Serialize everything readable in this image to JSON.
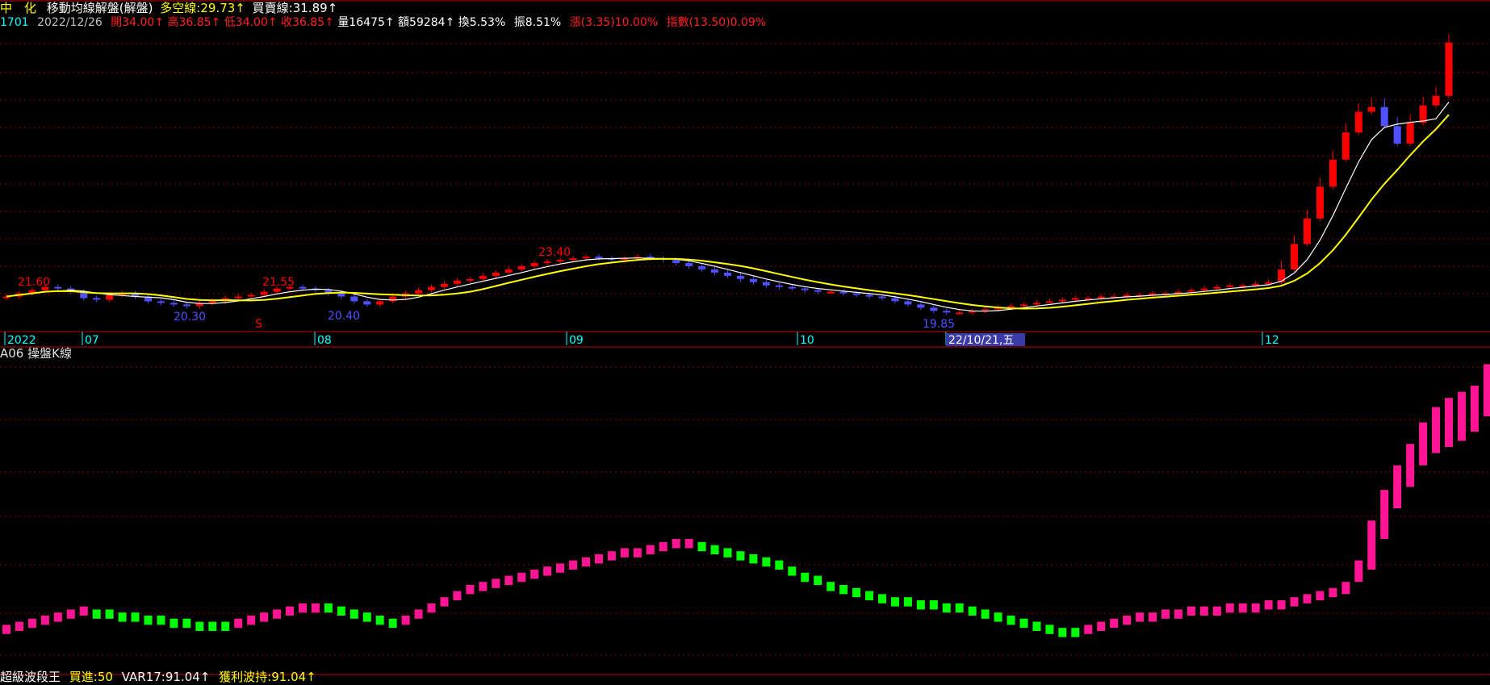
{
  "header": {
    "stock_name": "中　化",
    "indicator": "移動均線解盤(解盤)",
    "long_short_label": "多空線:29.73↑",
    "buy_sell_label": "買賣線:31.89↑"
  },
  "quote": {
    "code": "1701",
    "date": "2022/12/26",
    "open": "開34.00↑",
    "high": "高36.85↑",
    "low": "低34.00↑",
    "close": "收36.85↑",
    "volume": "量16475↑",
    "amount": "額59284↑",
    "turnover": "換5.53%",
    "amplitude": "振8.51%",
    "change": "漲(3.35)10.00%",
    "index": "指數(13.50)0.09%"
  },
  "sub_panel": {
    "title": "A06 操盤K線"
  },
  "footer": {
    "name": "超級波段王",
    "buy": "買進:50",
    "var": "VAR17:91.04↑",
    "profit": "獲利波持:91.04↑"
  },
  "colors": {
    "up": "#ff0000",
    "down": "#5050ff",
    "ma_fast": "#ffffff",
    "ma_slow": "#ffff00",
    "osc_up": "#ff1493",
    "osc_down": "#00ff00",
    "grid": "#8b0000",
    "axis_text": "#00ffff"
  },
  "chart_data": [
    {
      "type": "candlestick",
      "title": "移動均線解盤(解盤)",
      "x_labels": [
        "2022",
        "07",
        "08",
        "09",
        "10",
        "22/10/21,五",
        "12"
      ],
      "annotations": [
        {
          "text": "21.60",
          "kind": "high"
        },
        {
          "text": "21.55",
          "kind": "high"
        },
        {
          "text": "23.40",
          "kind": "high"
        },
        {
          "text": "20.30",
          "kind": "low"
        },
        {
          "text": "20.40",
          "kind": "low"
        },
        {
          "text": "19.85",
          "kind": "low"
        },
        {
          "text": "S",
          "kind": "signal"
        }
      ],
      "series": [
        {
          "name": "多空線",
          "value": 29.73
        },
        {
          "name": "買賣線",
          "value": 31.89
        }
      ],
      "ohlc_last": {
        "open": 34.0,
        "high": 36.85,
        "low": 34.0,
        "close": 36.85
      },
      "ylim": [
        19.0,
        38.0
      ],
      "close_values": [
        20.9,
        21.1,
        21.3,
        21.5,
        21.4,
        21.2,
        20.8,
        20.7,
        21.0,
        21.1,
        20.9,
        20.6,
        20.5,
        20.4,
        20.3,
        20.5,
        20.6,
        20.8,
        20.9,
        21.0,
        21.2,
        21.4,
        21.5,
        21.4,
        21.3,
        21.1,
        20.9,
        20.6,
        20.4,
        20.6,
        20.9,
        21.1,
        21.3,
        21.5,
        21.7,
        21.9,
        22.0,
        22.2,
        22.4,
        22.6,
        22.8,
        23.0,
        23.1,
        23.2,
        23.3,
        23.4,
        23.3,
        23.2,
        23.3,
        23.4,
        23.3,
        23.2,
        23.0,
        22.8,
        22.6,
        22.4,
        22.2,
        22.0,
        21.8,
        21.6,
        21.5,
        21.4,
        21.3,
        21.2,
        21.2,
        21.1,
        21.0,
        20.9,
        20.8,
        20.6,
        20.4,
        20.2,
        20.0,
        19.9,
        19.9,
        20.0,
        20.1,
        20.2,
        20.3,
        20.4,
        20.5,
        20.6,
        20.7,
        20.8,
        20.8,
        20.9,
        20.9,
        21.0,
        21.0,
        21.1,
        21.1,
        21.2,
        21.3,
        21.4,
        21.5,
        21.6,
        21.6,
        21.7,
        21.8,
        22.6,
        24.2,
        25.8,
        27.8,
        29.5,
        31.2,
        32.5,
        32.8,
        31.6,
        30.5,
        31.8,
        32.9,
        33.5,
        36.85
      ]
    },
    {
      "type": "bar",
      "title": "A06 操盤K線",
      "ylim": [
        0,
        100
      ],
      "values": [
        11,
        12,
        13,
        14,
        15,
        16,
        17,
        16,
        16,
        15,
        15,
        14,
        14,
        13,
        13,
        12,
        12,
        12,
        13,
        14,
        15,
        16,
        17,
        18,
        18,
        18,
        17,
        16,
        15,
        14,
        13,
        14,
        16,
        18,
        20,
        22,
        24,
        25,
        26,
        27,
        28,
        29,
        30,
        31,
        32,
        33,
        34,
        35,
        36,
        36,
        37,
        38,
        39,
        39,
        38,
        37,
        36,
        35,
        34,
        33,
        32,
        30,
        28,
        27,
        25,
        24,
        23,
        22,
        21,
        20,
        20,
        19,
        19,
        18,
        18,
        17,
        16,
        15,
        14,
        13,
        12,
        11,
        10,
        10,
        11,
        12,
        13,
        14,
        15,
        15,
        16,
        16,
        17,
        17,
        17,
        18,
        18,
        18,
        19,
        19,
        20,
        21,
        22,
        23,
        25,
        32,
        45,
        55,
        63,
        70,
        77,
        82,
        85,
        87,
        89,
        91.04
      ],
      "ranges": [
        [
          9,
          12
        ],
        [
          10,
          13
        ],
        [
          11,
          14
        ],
        [
          12,
          15
        ],
        [
          13,
          16
        ],
        [
          14,
          17
        ],
        [
          15,
          18
        ],
        [
          14,
          17
        ],
        [
          14,
          17
        ],
        [
          13,
          16
        ],
        [
          13,
          16
        ],
        [
          12,
          15
        ],
        [
          12,
          15
        ],
        [
          11,
          14
        ],
        [
          11,
          14
        ],
        [
          10,
          13
        ],
        [
          10,
          13
        ],
        [
          10,
          13
        ],
        [
          11,
          14
        ],
        [
          12,
          15
        ],
        [
          13,
          16
        ],
        [
          14,
          17
        ],
        [
          15,
          18
        ],
        [
          16,
          19
        ],
        [
          16,
          19
        ],
        [
          16,
          19
        ],
        [
          15,
          18
        ],
        [
          14,
          17
        ],
        [
          13,
          16
        ],
        [
          12,
          15
        ],
        [
          11,
          14
        ],
        [
          12,
          15
        ],
        [
          14,
          17
        ],
        [
          16,
          19
        ],
        [
          18,
          21
        ],
        [
          20,
          23
        ],
        [
          22,
          25
        ],
        [
          23,
          26
        ],
        [
          24,
          27
        ],
        [
          25,
          28
        ],
        [
          26,
          29
        ],
        [
          27,
          30
        ],
        [
          28,
          31
        ],
        [
          29,
          32
        ],
        [
          30,
          33
        ],
        [
          31,
          34
        ],
        [
          32,
          35
        ],
        [
          33,
          36
        ],
        [
          34,
          37
        ],
        [
          34,
          37
        ],
        [
          35,
          38
        ],
        [
          36,
          39
        ],
        [
          37,
          40
        ],
        [
          37,
          40
        ],
        [
          36,
          39
        ],
        [
          35,
          38
        ],
        [
          34,
          37
        ],
        [
          33,
          36
        ],
        [
          32,
          35
        ],
        [
          31,
          34
        ],
        [
          30,
          33
        ],
        [
          28,
          31
        ],
        [
          26,
          29
        ],
        [
          25,
          28
        ],
        [
          23,
          26
        ],
        [
          22,
          25
        ],
        [
          21,
          24
        ],
        [
          20,
          23
        ],
        [
          19,
          22
        ],
        [
          18,
          21
        ],
        [
          18,
          21
        ],
        [
          17,
          20
        ],
        [
          17,
          20
        ],
        [
          16,
          19
        ],
        [
          16,
          19
        ],
        [
          15,
          18
        ],
        [
          14,
          17
        ],
        [
          13,
          16
        ],
        [
          12,
          15
        ],
        [
          11,
          14
        ],
        [
          10,
          13
        ],
        [
          9,
          12
        ],
        [
          8,
          11
        ],
        [
          8,
          11
        ],
        [
          9,
          12
        ],
        [
          10,
          13
        ],
        [
          11,
          14
        ],
        [
          12,
          15
        ],
        [
          13,
          16
        ],
        [
          13,
          16
        ],
        [
          14,
          17
        ],
        [
          14,
          17
        ],
        [
          15,
          18
        ],
        [
          15,
          18
        ],
        [
          15,
          18
        ],
        [
          16,
          19
        ],
        [
          16,
          19
        ],
        [
          16,
          19
        ],
        [
          17,
          20
        ],
        [
          17,
          20
        ],
        [
          18,
          21
        ],
        [
          19,
          22
        ],
        [
          20,
          23
        ],
        [
          21,
          24
        ],
        [
          22,
          26
        ],
        [
          26,
          33
        ],
        [
          30,
          46
        ],
        [
          40,
          56
        ],
        [
          50,
          64
        ],
        [
          57,
          71
        ],
        [
          64,
          78
        ],
        [
          68,
          83
        ],
        [
          70,
          86
        ],
        [
          72,
          88
        ],
        [
          75,
          90
        ],
        [
          80,
          97
        ]
      ],
      "up_flags": [
        1,
        1,
        1,
        1,
        1,
        1,
        1,
        0,
        0,
        0,
        0,
        0,
        0,
        0,
        0,
        0,
        0,
        0,
        1,
        1,
        1,
        1,
        1,
        1,
        1,
        0,
        0,
        0,
        0,
        0,
        0,
        1,
        1,
        1,
        1,
        1,
        1,
        1,
        1,
        1,
        1,
        1,
        1,
        1,
        1,
        1,
        1,
        1,
        1,
        1,
        1,
        1,
        1,
        1,
        0,
        0,
        0,
        0,
        0,
        0,
        0,
        0,
        0,
        0,
        0,
        0,
        0,
        0,
        0,
        0,
        0,
        0,
        0,
        0,
        0,
        0,
        0,
        0,
        0,
        0,
        0,
        0,
        0,
        0,
        1,
        1,
        1,
        1,
        1,
        1,
        1,
        1,
        1,
        1,
        1,
        1,
        1,
        1,
        1,
        1,
        1,
        1,
        1,
        1,
        1,
        1,
        1,
        1,
        1,
        1,
        1,
        1,
        1,
        1,
        1,
        1
      ]
    }
  ]
}
